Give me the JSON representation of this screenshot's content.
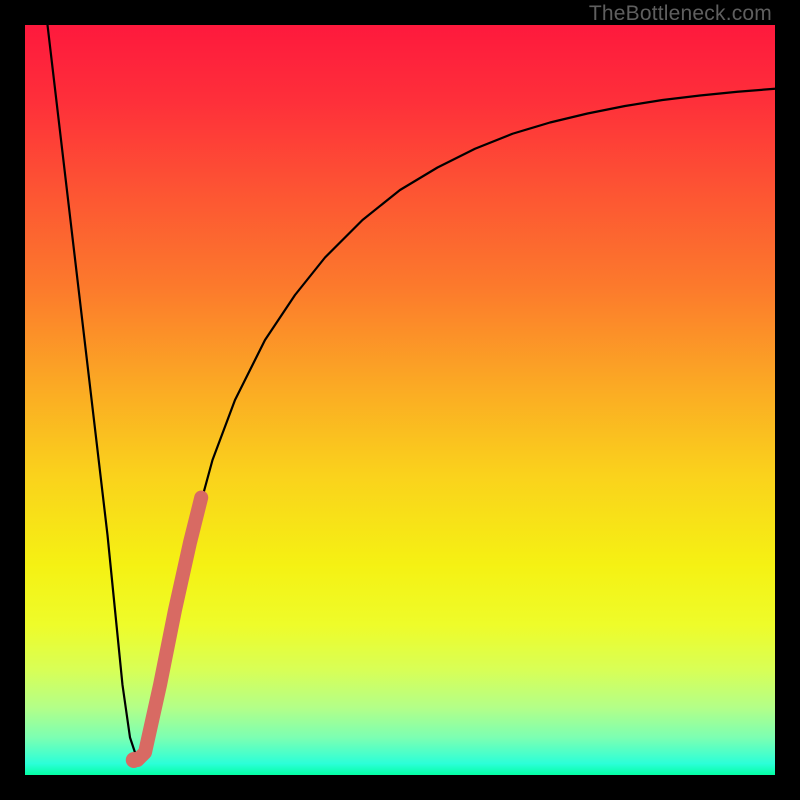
{
  "watermark": "TheBottleneck.com",
  "colors": {
    "frame": "#000000",
    "curve": "#000000",
    "marker": "#d86a63",
    "gradient_stops": [
      {
        "offset": 0.0,
        "color": "#fe193d"
      },
      {
        "offset": 0.1,
        "color": "#fe2f3a"
      },
      {
        "offset": 0.22,
        "color": "#fd5433"
      },
      {
        "offset": 0.35,
        "color": "#fc7a2c"
      },
      {
        "offset": 0.48,
        "color": "#fba924"
      },
      {
        "offset": 0.6,
        "color": "#fad21c"
      },
      {
        "offset": 0.72,
        "color": "#f5f113"
      },
      {
        "offset": 0.8,
        "color": "#eefc2a"
      },
      {
        "offset": 0.86,
        "color": "#d8ff56"
      },
      {
        "offset": 0.91,
        "color": "#b3ff88"
      },
      {
        "offset": 0.95,
        "color": "#7cffb2"
      },
      {
        "offset": 0.985,
        "color": "#2bffd8"
      },
      {
        "offset": 1.0,
        "color": "#03ffa4"
      }
    ]
  },
  "chart_data": {
    "type": "line",
    "title": "",
    "xlabel": "",
    "ylabel": "",
    "xlim": [
      0,
      100
    ],
    "ylim": [
      0,
      100
    ],
    "series": [
      {
        "name": "bottleneck-curve",
        "x": [
          3,
          5,
          7,
          9,
          11,
          12,
          13,
          14,
          15,
          16,
          18,
          20,
          22,
          25,
          28,
          32,
          36,
          40,
          45,
          50,
          55,
          60,
          65,
          70,
          75,
          80,
          85,
          90,
          95,
          100
        ],
        "y": [
          100,
          83,
          66,
          49,
          32,
          22,
          12,
          5,
          2,
          3,
          12,
          22,
          31,
          42,
          50,
          58,
          64,
          69,
          74,
          78,
          81,
          83.5,
          85.5,
          87,
          88.2,
          89.2,
          90,
          90.6,
          91.1,
          91.5
        ]
      }
    ],
    "markers": [
      {
        "name": "highlight-segment",
        "x": [
          14.5,
          15,
          16,
          18,
          20,
          22,
          23.5
        ],
        "y": [
          2,
          2,
          3,
          12,
          22,
          31,
          37
        ]
      }
    ],
    "minimum": {
      "x": 14.5,
      "y": 2
    }
  }
}
